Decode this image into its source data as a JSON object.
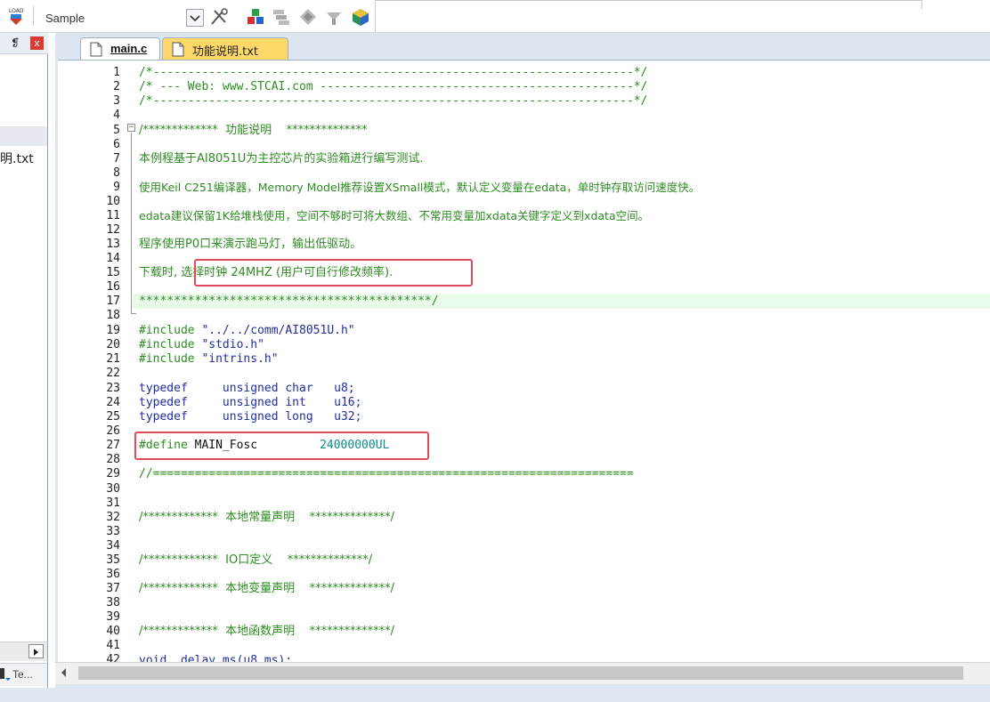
{
  "toolbar": {
    "load_label": "LOAD",
    "target_name": "Sample",
    "icons": [
      "load-icon",
      "dropdown-arrow-icon",
      "target-options-icon",
      "manage-components-icon",
      "file-extensions-icon",
      "select-packs-icon",
      "manage-runtime-icon",
      "pack-installer-icon"
    ]
  },
  "left_panel": {
    "pin_symbol": "❡",
    "close_symbol": "x",
    "file_label": "明.txt",
    "bottom_tab_label": "Te..."
  },
  "tabs": [
    {
      "label": "main.c",
      "active": true
    },
    {
      "label": "功能说明.txt",
      "active": false
    }
  ],
  "editor": {
    "line_numbers": [
      "1",
      "2",
      "3",
      "4",
      "5",
      "6",
      "7",
      "8",
      "9",
      "10",
      "11",
      "12",
      "13",
      "14",
      "15",
      "16",
      "17",
      "18",
      "19",
      "20",
      "21",
      "22",
      "23",
      "24",
      "25",
      "26",
      "27",
      "28",
      "29",
      "30",
      "31",
      "32",
      "33",
      "34",
      "35",
      "36",
      "37",
      "38",
      "39",
      "40",
      "41",
      "42"
    ],
    "lines": {
      "l1": "/*---------------------------------------------------------------------*/",
      "l2": "/* --- Web: www.STCAI.com ---------------------------------------------*/",
      "l3": "/*---------------------------------------------------------------------*/",
      "l5": "/*************  功能说明    **************",
      "l7": "本例程基于AI8051U为主控芯片的实验箱进行编写测试.",
      "l9": "使用Keil C251编译器，Memory Model推荐设置XSmall模式，默认定义变量在edata，单时钟存取访问速度快。",
      "l11": "edata建议保留1K给堆栈使用，空间不够时可将大数组、不常用变量加xdata关键字定义到xdata空间。",
      "l13": "程序使用P0口来演示跑马灯，输出低驱动。",
      "l15a": "下载时, ",
      "l15b": "选择时钟 24MHZ (用户可自行修改频率).",
      "l17": "******************************************/",
      "l19_kw": "#include",
      "l19_str": " \"../../comm/AI8051U.h\"",
      "l20_kw": "#include",
      "l20_str": " \"stdio.h\"",
      "l21_kw": "#include",
      "l21_str": " \"intrins.h\"",
      "l23": "typedef     unsigned char   u8;",
      "l24": "typedef     unsigned int    u16;",
      "l25": "typedef     unsigned long   u32;",
      "l27_kw": "#define",
      "l27_id": " MAIN_Fosc",
      "l27_num": "24000000UL",
      "l29": "//=====================================================================",
      "l32": "/*************  本地常量声明    **************/",
      "l35": "/*************  IO口定义    **************/",
      "l37": "/*************  本地变量声明    **************/",
      "l40": "/*************  本地函数声明    **************/",
      "l42": "void  delay_ms(u8 ms);"
    }
  },
  "colors": {
    "comment": "#2e8b22",
    "keyword": "#1f2f9f",
    "number": "#0f8a8a",
    "highlight_box": "#e14a5a",
    "current_line": "#e8fbe8",
    "active_tab": "#ffffff",
    "inactive_tab": "#ffd86a"
  }
}
